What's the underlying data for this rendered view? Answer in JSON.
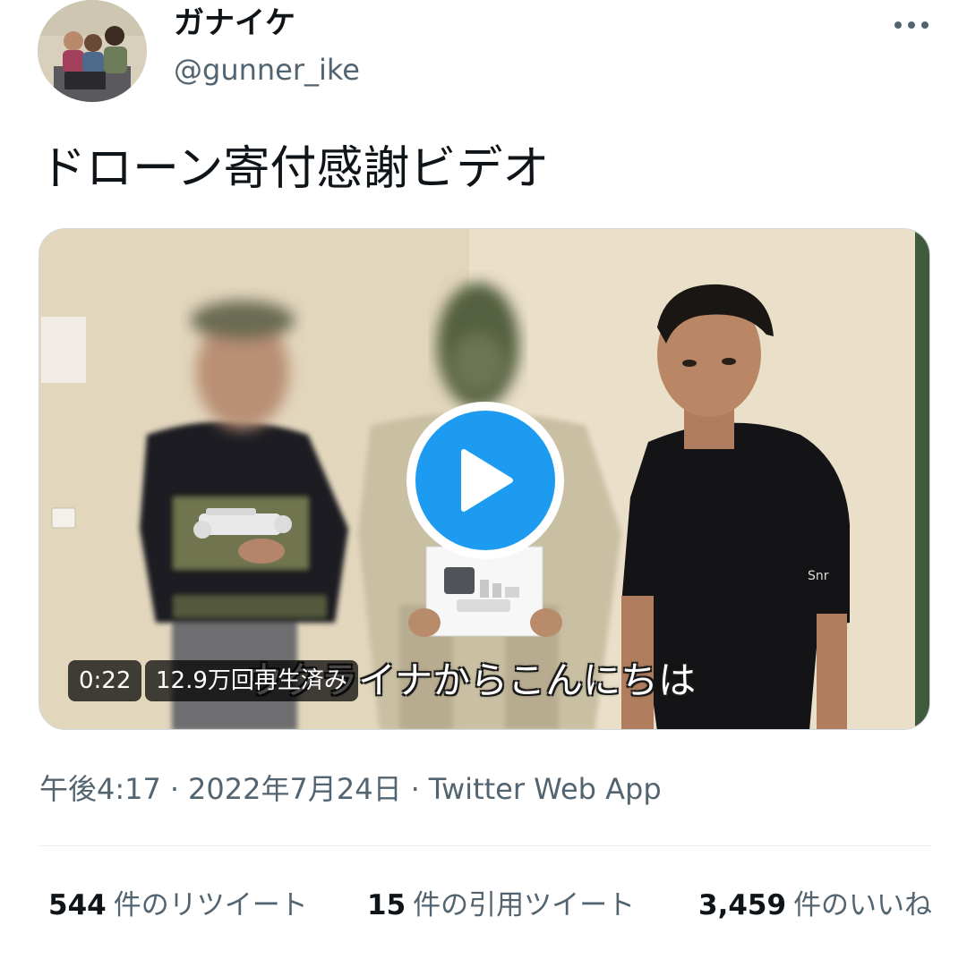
{
  "author": {
    "display_name": "ガナイケ",
    "handle": "@gunner_ike",
    "avatar_icon": "avatar-photo"
  },
  "tweet": {
    "text": "ドローン寄付感謝ビデオ"
  },
  "media": {
    "duration": "0:22",
    "views": "12.9万回再生済み",
    "subtitle": "ウクライナからこんにちは",
    "play_icon": "play-icon"
  },
  "meta": {
    "time": "午後4:17",
    "separator": "·",
    "date": "2022年7月24日",
    "source": "Twitter Web App"
  },
  "stats": {
    "retweets": {
      "count": "544",
      "label": "件のリツイート"
    },
    "quotes": {
      "count": "15",
      "label": "件の引用ツイート"
    },
    "likes": {
      "count": "3,459",
      "label": "件のいいね"
    }
  },
  "colors": {
    "accent": "#1d9bf0",
    "text_primary": "#0f1419",
    "text_secondary": "#536471",
    "divider": "#e6ecf0"
  }
}
